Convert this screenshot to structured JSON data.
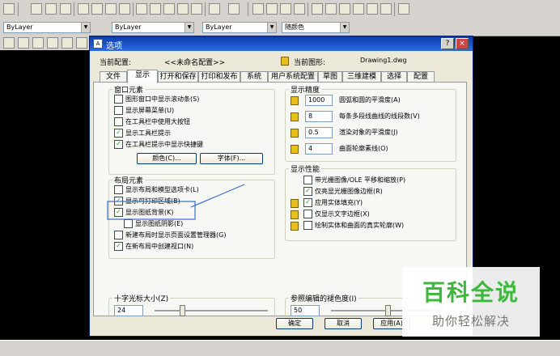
{
  "toolbar2": {
    "layer_combo": "ByLayer",
    "linetype_combo": "ByLayer",
    "lineweight_combo": "ByLayer",
    "color_combo": "随颜色"
  },
  "dialog": {
    "title": "选项",
    "help_button": "?",
    "close_button": "×",
    "current_profile_label": "当前配置:",
    "current_profile_value": "<<未命名配置>>",
    "current_drawing_label": "当前图形:",
    "current_drawing_value": "Drawing1.dwg",
    "tabs": [
      "文件",
      "显示",
      "打开和保存",
      "打印和发布",
      "系统",
      "用户系统配置",
      "草图",
      "三维建模",
      "选择",
      "配置"
    ],
    "window_elements": {
      "title": "窗口元素",
      "items": [
        {
          "label": "图形窗口中显示滚动条(S)",
          "checked": false
        },
        {
          "label": "显示屏幕菜单(U)",
          "checked": false
        },
        {
          "label": "在工具栏中使用大按钮",
          "checked": false
        },
        {
          "label": "显示工具栏提示",
          "checked": true
        },
        {
          "label": "在工具栏提示中显示快捷键",
          "checked": true
        }
      ],
      "colors_button": "颜色(C)...",
      "fonts_button": "字体(F)..."
    },
    "layout_elements": {
      "title": "布局元素",
      "items": [
        {
          "label": "显示布局和模型选项卡(L)",
          "checked": false
        },
        {
          "label": "显示可打印区域(B)",
          "checked": true
        },
        {
          "label": "显示图纸背景(K)",
          "checked": true
        },
        {
          "label": "显示图纸阴影(E)",
          "checked": false
        },
        {
          "label": "新建布局时显示页面设置管理器(G)",
          "checked": false
        },
        {
          "label": "在新布局中创建视口(N)",
          "checked": true
        }
      ]
    },
    "crosshair": {
      "title": "十字光标大小(Z)",
      "value": "24",
      "level_percent": 24
    },
    "display_resolution": {
      "title": "显示精度",
      "items": [
        {
          "value": "1000",
          "label": "圆弧和圆的平滑度(A)"
        },
        {
          "value": "8",
          "label": "每条多段线曲线的线段数(V)"
        },
        {
          "value": "0.5",
          "label": "渲染对象的平滑度(J)"
        },
        {
          "value": "4",
          "label": "曲面轮廓素线(O)"
        }
      ]
    },
    "display_performance": {
      "title": "显示性能",
      "items": [
        {
          "label": "带光栅图像/OLE 平移和缩放(P)",
          "checked": false
        },
        {
          "label": "仅亮显光栅图像边框(R)",
          "checked": true
        },
        {
          "label": "应用实体填充(Y)",
          "checked": true
        },
        {
          "label": "仅显示文字边框(X)",
          "checked": false
        },
        {
          "label": "绘制实体和曲面的真实轮廓(W)",
          "checked": false
        }
      ]
    },
    "xref_fade": {
      "title": "参照编辑的褪色度(I)",
      "value": "50",
      "level_percent": 50
    },
    "ok_button": "确定",
    "cancel_button": "取消",
    "apply_button": "应用(A)"
  },
  "watermark": {
    "line1": "百科全说",
    "line2": "助你轻松解决"
  }
}
